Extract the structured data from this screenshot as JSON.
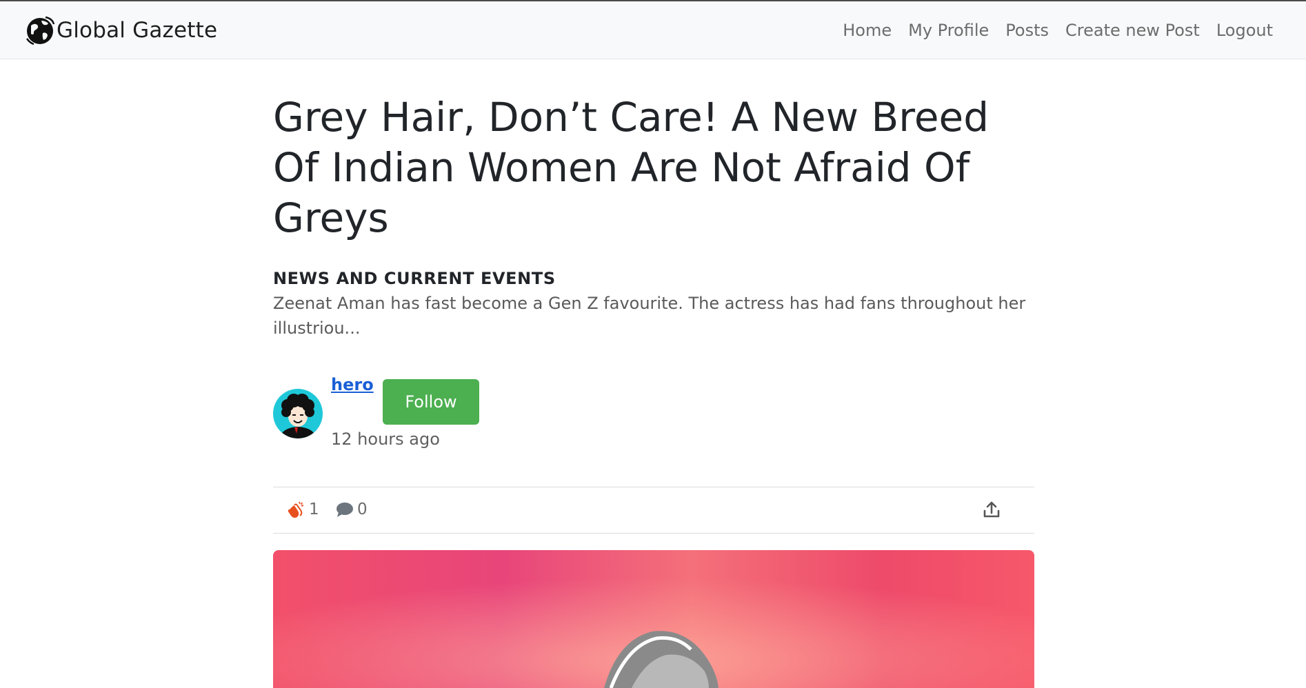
{
  "header": {
    "brand": "Global Gazette",
    "nav": [
      "Home",
      "My Profile",
      "Posts",
      "Create new Post",
      "Logout"
    ]
  },
  "article": {
    "title": "Grey Hair, Don’t Care! A New Breed Of Indian Women Are Not Afraid Of Greys",
    "category": "NEWS AND CURRENT EVENTS",
    "excerpt": "Zeenat Aman has fast become a Gen Z favourite. The actress has had fans throughout her illustriou...",
    "author": "hero",
    "follow_label": "Follow",
    "time_ago": "12 hours ago"
  },
  "actions": {
    "claps": "1",
    "comments": "0"
  },
  "icons": {
    "brand": "globe-icon",
    "clap": "clap-icon",
    "comment": "comment-icon",
    "share": "share-icon"
  },
  "colors": {
    "navbar_bg": "#f8f9fa",
    "follow_button": "#4caf50",
    "author_link": "#1a5fd6",
    "clap_icon": "#e8501f"
  }
}
